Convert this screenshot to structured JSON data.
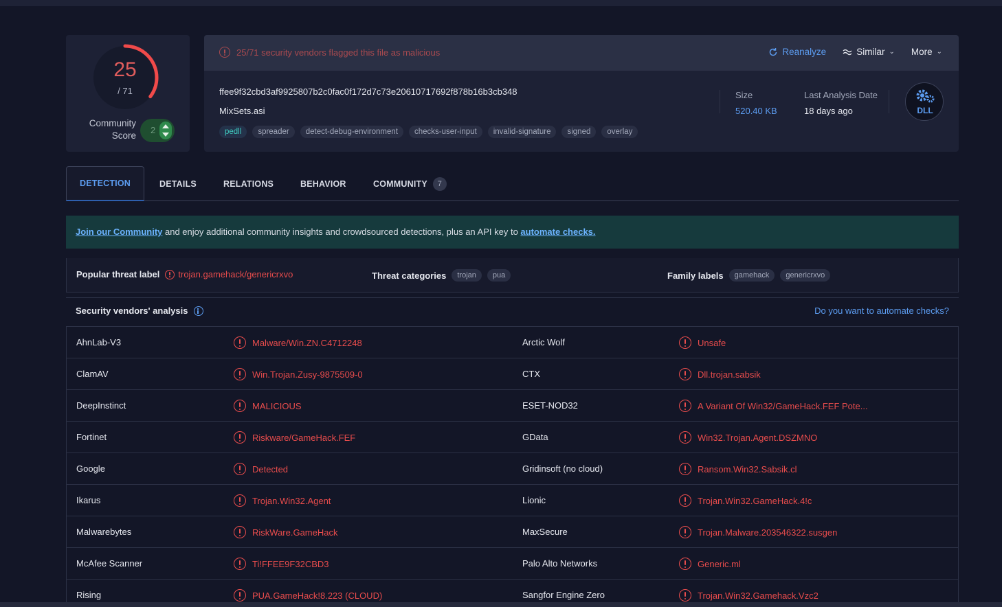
{
  "score": {
    "detections": "25",
    "total": "/ 71",
    "community_label_1": "Community",
    "community_label_2": "Score",
    "community_value": "2",
    "accent": "#f04a4a"
  },
  "header": {
    "flag_text": "25/71 security vendors flagged this file as malicious",
    "reanalyze": "Reanalyze",
    "similar": "Similar",
    "more": "More"
  },
  "file": {
    "hash": "ffee9f32cbd3af9925807b2c0fac0f172d7c73e20610717692f878b16b3cb348",
    "name": "MixSets.asi",
    "tags": [
      "pedll",
      "spreader",
      "detect-debug-environment",
      "checks-user-input",
      "invalid-signature",
      "signed",
      "overlay"
    ],
    "size_label": "Size",
    "size_value": "520.40 KB",
    "date_label": "Last Analysis Date",
    "date_value": "18 days ago",
    "type_badge": "DLL"
  },
  "tabs": [
    {
      "label": "DETECTION",
      "active": true
    },
    {
      "label": "DETAILS"
    },
    {
      "label": "RELATIONS"
    },
    {
      "label": "BEHAVIOR"
    },
    {
      "label": "COMMUNITY",
      "badge": "7"
    }
  ],
  "banner": {
    "link1": "Join our Community",
    "text": " and enjoy additional community insights and crowdsourced detections, plus an API key to ",
    "link2": "automate checks."
  },
  "threat": {
    "popular_label": "Popular threat label",
    "popular_value": "trojan.gamehack/genericrxvo",
    "categories_label": "Threat categories",
    "categories": [
      "trojan",
      "pua"
    ],
    "family_label": "Family labels",
    "families": [
      "gamehack",
      "genericrxvo"
    ]
  },
  "vendors_header": {
    "title": "Security vendors' analysis",
    "link": "Do you want to automate checks?"
  },
  "vendors": [
    [
      "AhnLab-V3",
      "Malware/Win.ZN.C4712248",
      "Arctic Wolf",
      "Unsafe"
    ],
    [
      "ClamAV",
      "Win.Trojan.Zusy-9875509-0",
      "CTX",
      "Dll.trojan.sabsik"
    ],
    [
      "DeepInstinct",
      "MALICIOUS",
      "ESET-NOD32",
      "A Variant Of Win32/GameHack.FEF Pote..."
    ],
    [
      "Fortinet",
      "Riskware/GameHack.FEF",
      "GData",
      "Win32.Trojan.Agent.DSZMNO"
    ],
    [
      "Google",
      "Detected",
      "Gridinsoft (no cloud)",
      "Ransom.Win32.Sabsik.cl"
    ],
    [
      "Ikarus",
      "Trojan.Win32.Agent",
      "Lionic",
      "Trojan.Win32.GameHack.4!c"
    ],
    [
      "Malwarebytes",
      "RiskWare.GameHack",
      "MaxSecure",
      "Trojan.Malware.203546322.susgen"
    ],
    [
      "McAfee Scanner",
      "Ti!FFEE9F32CBD3",
      "Palo Alto Networks",
      "Generic.ml"
    ],
    [
      "Rising",
      "PUA.GameHack!8.223 (CLOUD)",
      "Sangfor Engine Zero",
      "Trojan.Win32.Gamehack.Vzc2"
    ]
  ]
}
